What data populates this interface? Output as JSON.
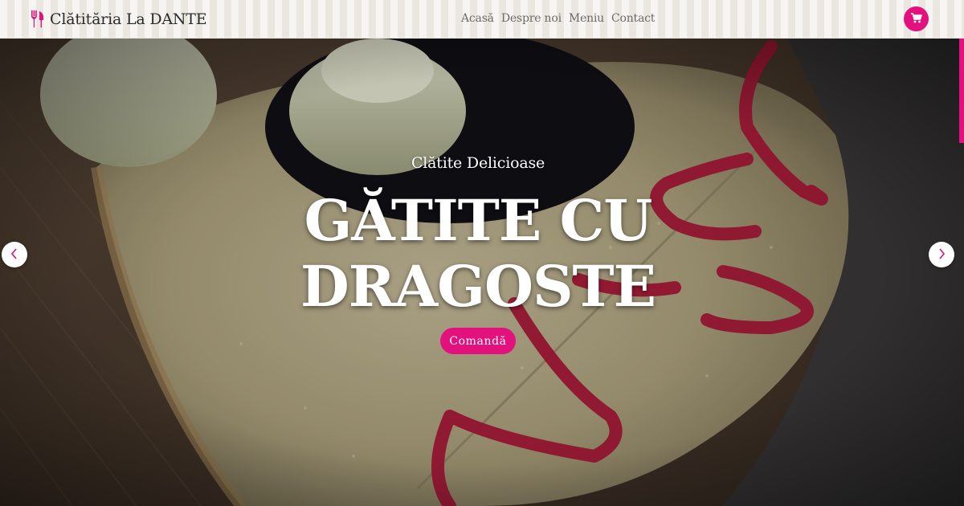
{
  "header": {
    "brand_name": "Clătităria La DANTE",
    "brand_icon": "fork-knife-icon",
    "nav": [
      {
        "label": "Acasă"
      },
      {
        "label": "Despre noi"
      },
      {
        "label": "Meniu"
      },
      {
        "label": "Contact"
      }
    ],
    "cart_icon": "cart-icon"
  },
  "hero": {
    "kicker": "Clătite Delicioase",
    "title": "GĂTITE CU DRAGOSTE",
    "order_button": "Comandă",
    "prev_icon": "chevron-left-icon",
    "next_icon": "chevron-right-icon"
  },
  "colors": {
    "accent": "#e2117d",
    "header_bg": "#f6f5f1",
    "nav_text": "#6b6b6b",
    "brand_text": "#2b2b2b"
  }
}
